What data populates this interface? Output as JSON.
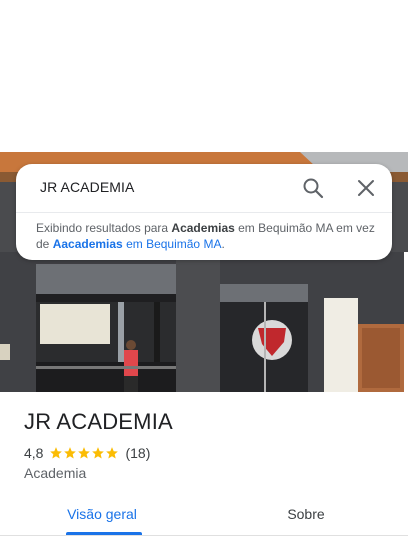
{
  "search": {
    "query": "JR ACADEMIA",
    "search_icon": "search-icon",
    "close_icon": "close-icon",
    "notice": {
      "prefix": "Exibindo resultados para ",
      "term": "Academias",
      "location_text": " em Bequimão MA em vez de ",
      "original_term": "Aacademias",
      "original_location": " em Bequimão MA",
      "suffix": "."
    }
  },
  "place": {
    "name": "JR ACADEMIA",
    "rating": "4,8",
    "stars": 4.8,
    "review_count": "(18)",
    "category": "Academia"
  },
  "tabs": [
    {
      "label": "Visão geral",
      "active": true
    },
    {
      "label": "Sobre",
      "active": false
    }
  ],
  "colors": {
    "accent": "#1a73e8",
    "star": "#fbbc04"
  }
}
